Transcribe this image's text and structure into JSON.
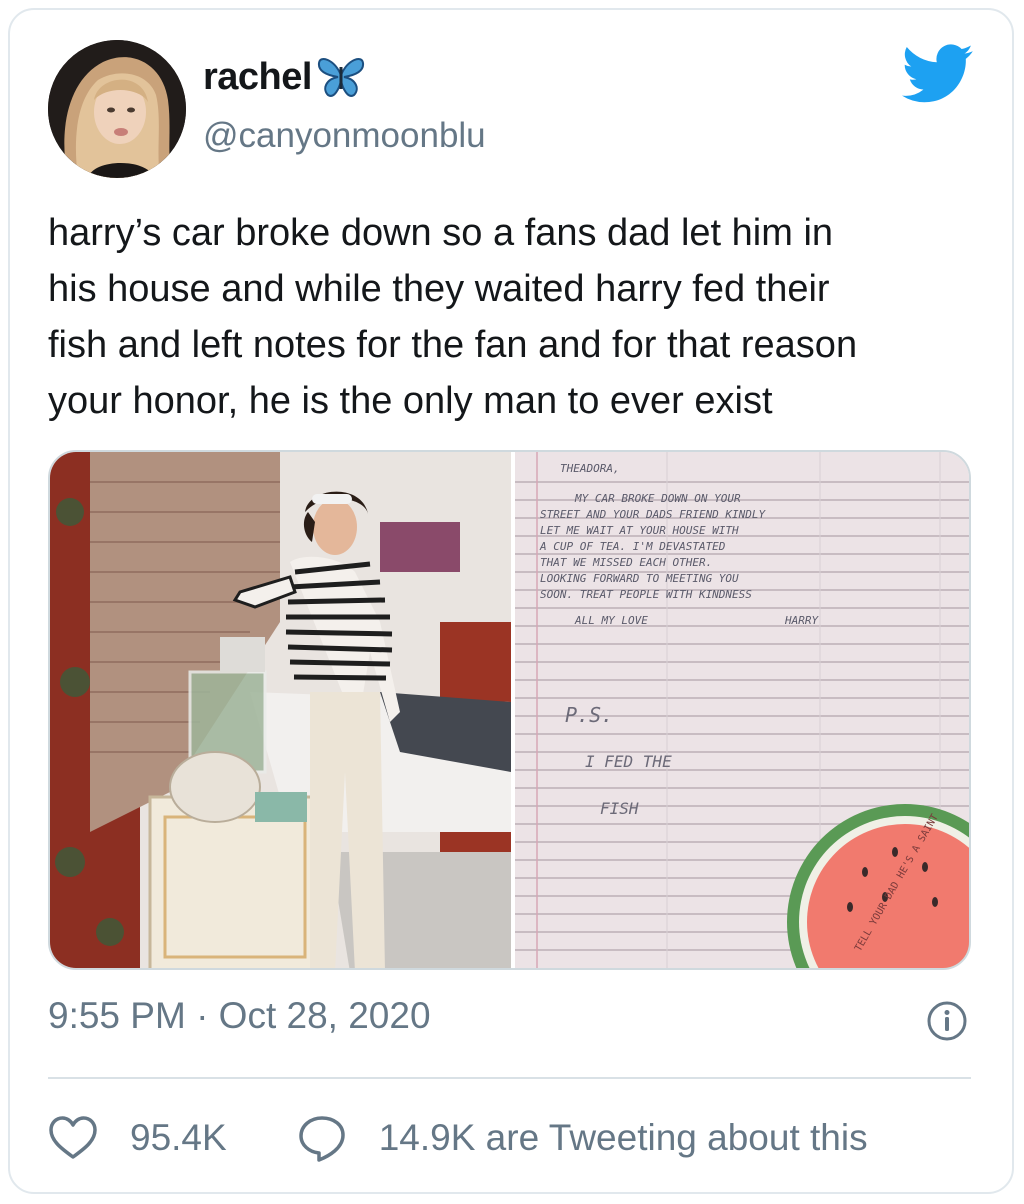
{
  "user": {
    "display_name": "rachel",
    "handle": "@canyonmoonblu",
    "name_emoji_icon": "butterfly-icon"
  },
  "tweet": {
    "text": "harry’s car broke down so a fans dad let him in\nhis house and while they waited harry fed their\nfish and left notes for the fan and for that reason\nyour honor, he is the only man to ever exist",
    "timestamp": "9:55 PM · Oct 28, 2020"
  },
  "note": {
    "heading": "THEADORA,",
    "lines": [
      "MY CAR BROKE DOWN ON YOUR",
      "STREET AND YOUR DADS FRIEND KINDLY",
      "LET ME WAIT AT YOUR HOUSE WITH",
      "A CUP OF TEA. I'M DEVASTATED",
      "THAT WE MISSED EACH OTHER.",
      "LOOKING FORWARD TO MEETING YOU",
      "SOON. TREAT PEOPLE WITH KINDNESS",
      "ALL MY LOVE",
      "HARRY"
    ],
    "ps": "P.S.",
    "ps_line1": "I FED THE",
    "ps_line2": "FISH",
    "corner_text": "TELL YOUR DAD HE'S A SAINT"
  },
  "stats": {
    "likes": "95.4K",
    "retweet_text": "14.9K are Tweeting about this"
  },
  "colors": {
    "twitter_blue": "#1da1f2",
    "secondary_text": "#657786",
    "divider": "#d9e1e6"
  },
  "icons": {
    "brand": "twitter-bird-icon",
    "info": "info-icon",
    "like": "heart-icon",
    "reply": "speech-bubble-icon"
  }
}
